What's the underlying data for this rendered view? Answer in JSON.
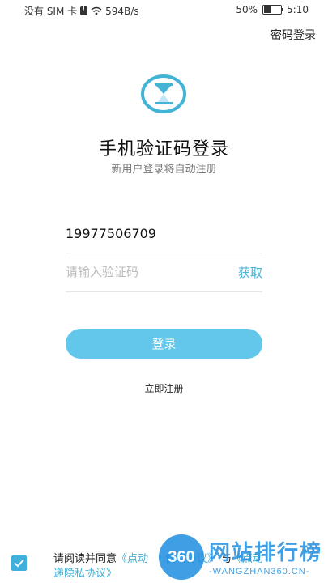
{
  "status_bar": {
    "carrier": "没有 SIM 卡",
    "speed": "594B/s",
    "battery": "50%",
    "time": "5:10"
  },
  "header": {
    "password_login": "密码登录"
  },
  "main": {
    "title": "手机验证码登录",
    "subtitle": "新用户登录将自动注册",
    "phone_value": "19977506709",
    "code_placeholder": "请输入验证码",
    "get_code_label": "获取",
    "login_label": "登录",
    "register_label": "立即注册"
  },
  "agreement": {
    "checked": true,
    "prefix": "请阅读并同意",
    "link_user": "《点动",
    "link_middle": "使用协议》",
    "conj": "与",
    "link_tail": "《点动",
    "link_privacy": "递隐私协议》"
  },
  "watermark": {
    "badge": "360",
    "title": "网站排行榜",
    "subtitle": "-WANGZHAN360.CN-"
  },
  "colors": {
    "accent": "#43b3d6",
    "button": "#62c7ea",
    "checkbox": "#3fb0dc"
  }
}
